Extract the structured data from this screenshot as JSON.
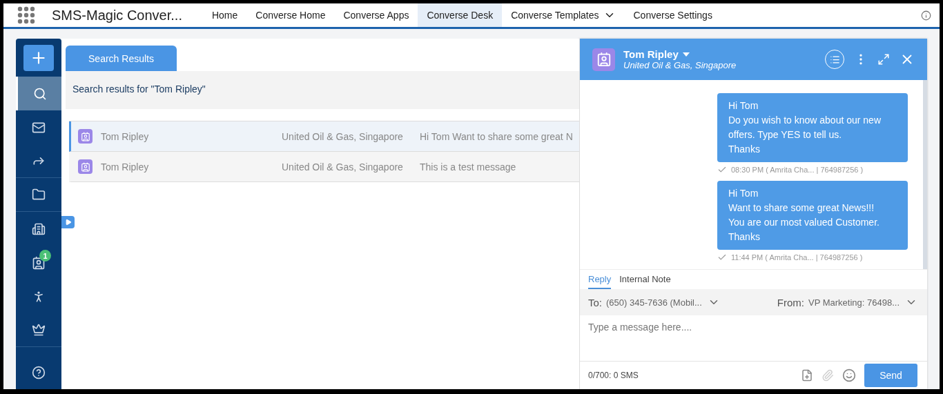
{
  "app_title": "SMS-Magic Conver...",
  "nav": [
    {
      "label": "Home",
      "selected": false,
      "kind": "link"
    },
    {
      "label": "Converse Home",
      "selected": false,
      "kind": "link"
    },
    {
      "label": "Converse Apps",
      "selected": false,
      "kind": "link"
    },
    {
      "label": "Converse Desk",
      "selected": true,
      "kind": "link"
    },
    {
      "label": "Converse Templates",
      "selected": false,
      "kind": "dropdown"
    },
    {
      "label": "Converse Settings",
      "selected": false,
      "kind": "link"
    }
  ],
  "sidebar": [
    {
      "kind": "new",
      "selected": false,
      "divider": false
    },
    {
      "kind": "search",
      "selected": true,
      "divider": false
    },
    {
      "kind": "inbox",
      "selected": false,
      "divider": false
    },
    {
      "kind": "forward",
      "selected": false,
      "divider": true
    },
    {
      "kind": "folder",
      "selected": false,
      "divider": true
    },
    {
      "kind": "buildings",
      "selected": false,
      "divider": false
    },
    {
      "kind": "contacts",
      "selected": false,
      "divider": false,
      "badge": "1"
    },
    {
      "kind": "person",
      "selected": false,
      "divider": false
    },
    {
      "kind": "crown",
      "selected": false,
      "divider": true
    },
    {
      "kind": "help",
      "selected": false,
      "divider": false
    }
  ],
  "tabs": [
    {
      "label": "Search Results",
      "selected": true
    }
  ],
  "search_summary": "Search results for \"Tom Ripley\"",
  "results": [
    {
      "name": "Tom Ripley",
      "company": "United Oil & Gas, Singapore",
      "message": "Hi Tom Want to share some great N",
      "selected": true
    },
    {
      "name": "Tom Ripley",
      "company": "United Oil & Gas, Singapore",
      "message": "This is a test message",
      "selected": false
    }
  ],
  "chat": {
    "name": "Tom Ripley",
    "subtitle": "United Oil & Gas, Singapore",
    "messages": [
      {
        "lines": [
          "Hi Tom",
          "Do you wish to know about our new offers. Type YES to tell us.",
          "Thanks"
        ],
        "meta": "08:30 PM ( Amrita Cha... | 764987256 )",
        "delivered": true
      },
      {
        "lines": [
          "Hi Tom",
          "Want to share some great News!!!",
          "You are our most valued Customer.",
          "Thanks"
        ],
        "meta": "11:44 PM ( Amrita Cha... | 764987256 )",
        "delivered": true
      }
    ],
    "compose_tabs": [
      {
        "label": "Reply",
        "selected": true
      },
      {
        "label": "Internal Note",
        "selected": false
      }
    ],
    "to_label": "To:",
    "to_value": "(650) 345-7636 (Mobil...",
    "from_label": "From:",
    "from_value": "VP Marketing: 76498...",
    "placeholder": "Type a message here....",
    "counter": "0/700: 0 SMS",
    "attachment_disabled": true,
    "send": "Send"
  }
}
